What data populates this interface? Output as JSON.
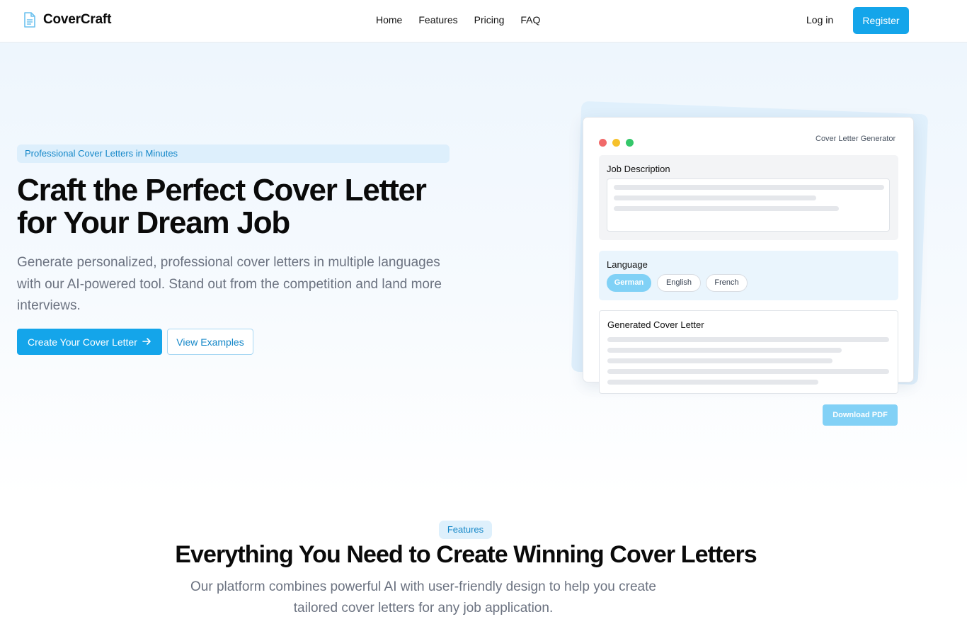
{
  "header": {
    "logo_text": "CoverCraft",
    "nav": [
      "Home",
      "Features",
      "Pricing",
      "FAQ"
    ],
    "login": "Log in",
    "register": "Register"
  },
  "hero": {
    "badge": "Professional Cover Letters in Minutes",
    "title_line1": "Craft the Perfect Cover Letter",
    "title_line2": "for Your Dream Job",
    "subtitle": "Generate personalized, professional cover letters in multiple languages with our AI-powered tool. Stand out from the competition and land more interviews.",
    "cta_primary": "Create Your Cover Letter",
    "cta_secondary": "View Examples"
  },
  "mockup": {
    "window_title": "Cover Letter Generator",
    "job_description_label": "Job Description",
    "language_label": "Language",
    "languages": [
      "German",
      "English",
      "French"
    ],
    "selected_language": "German",
    "generated_label": "Generated Cover Letter",
    "download_label": "Download PDF"
  },
  "features": {
    "badge": "Features",
    "title": "Everything You Need to Create Winning Cover Letters",
    "subtitle": "Our platform combines powerful AI with user-friendly design to help you create tailored cover letters for any job application."
  },
  "colors": {
    "accent": "#14a5ea",
    "accent_light": "#82d1f6",
    "text_muted": "#6b7280"
  }
}
